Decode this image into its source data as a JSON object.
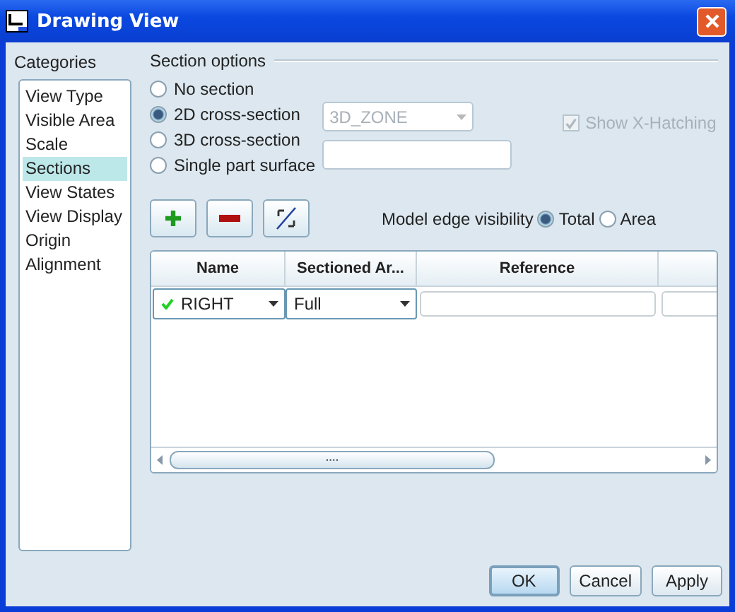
{
  "window": {
    "title": "Drawing View"
  },
  "categories": {
    "label": "Categories",
    "items": [
      {
        "label": "View Type",
        "selected": false
      },
      {
        "label": "Visible Area",
        "selected": false
      },
      {
        "label": "Scale",
        "selected": false
      },
      {
        "label": "Sections",
        "selected": true
      },
      {
        "label": "View States",
        "selected": false
      },
      {
        "label": "View Display",
        "selected": false
      },
      {
        "label": "Origin",
        "selected": false
      },
      {
        "label": "Alignment",
        "selected": false
      }
    ]
  },
  "section_options": {
    "title": "Section options",
    "options": [
      {
        "label": "No section",
        "selected": false
      },
      {
        "label": "2D cross-section",
        "selected": true
      },
      {
        "label": "3D cross-section",
        "selected": false
      },
      {
        "label": "Single part surface",
        "selected": false
      }
    ],
    "zone_combo": {
      "value": "3D_ZONE",
      "disabled": true
    },
    "show_x_hatching": {
      "label": "Show X-Hatching",
      "checked": true,
      "disabled": true
    }
  },
  "edge_visibility": {
    "label": "Model edge visibility",
    "options": [
      {
        "label": "Total",
        "selected": true
      },
      {
        "label": "Area",
        "selected": false
      }
    ]
  },
  "table": {
    "columns": [
      "Name",
      "Sectioned Ar...",
      "Reference"
    ],
    "rows": [
      {
        "name": "RIGHT",
        "valid": true,
        "area": "Full"
      }
    ]
  },
  "buttons": [
    {
      "label": "OK",
      "default": true
    },
    {
      "label": "Cancel",
      "default": false
    },
    {
      "label": "Apply",
      "default": false
    }
  ]
}
